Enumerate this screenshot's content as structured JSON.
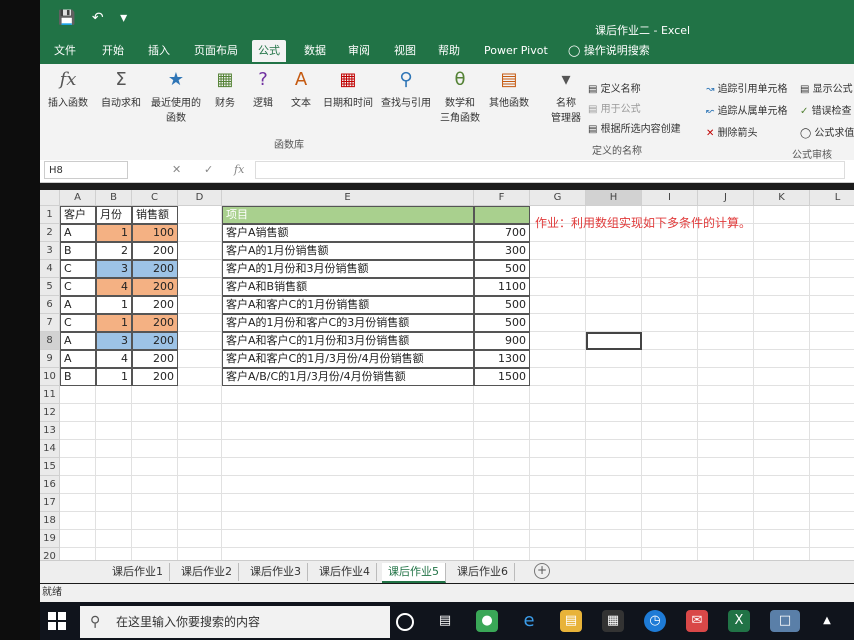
{
  "window": {
    "qat": "💾 ↶ ▾",
    "title": "课后作业二 - Excel"
  },
  "ribbon_tabs": [
    "文件",
    "开始",
    "插入",
    "页面布局",
    "公式",
    "数据",
    "审阅",
    "视图",
    "帮助",
    "Power Pivot",
    "操作说明搜索"
  ],
  "ribbon": {
    "insert_function": "插入函数",
    "autosum": "自动求和",
    "recent_1": "最近使用的",
    "recent_2": "函数",
    "financial": "财务",
    "logical": "逻辑",
    "text": "文本",
    "datetime": "日期和时间",
    "lookup": "查找与引用",
    "math_1": "数学和",
    "math_2": "三角函数",
    "more": "其他函数",
    "group_library": "函数库",
    "name_manager_1": "名称",
    "name_manager_2": "管理器",
    "define_name": "定义名称",
    "use_in_formula": "用于公式",
    "create_from_selection": "根据所选内容创建",
    "group_names": "定义的名称",
    "trace_precedents": "追踪引用单元格",
    "trace_dependents": "追踪从属单元格",
    "remove_arrows": "删除箭头",
    "show_formulas": "显示公式",
    "error_checking": "错误检查",
    "evaluate": "公式求值",
    "group_audit": "公式审核"
  },
  "formula_bar": {
    "namebox": "H8",
    "fx": "fx"
  },
  "columns": [
    "A",
    "B",
    "C",
    "D",
    "E",
    "F",
    "G",
    "H",
    "I",
    "J",
    "K",
    "L"
  ],
  "rows": [
    "1",
    "2",
    "3",
    "4",
    "5",
    "6",
    "7",
    "8",
    "9",
    "10",
    "11",
    "12",
    "13",
    "14",
    "15",
    "16",
    "17",
    "18",
    "19",
    "20"
  ],
  "table1": {
    "headers": [
      "客户",
      "月份",
      "销售额"
    ],
    "rows": [
      [
        "A",
        "1",
        "100"
      ],
      [
        "B",
        "2",
        "200"
      ],
      [
        "C",
        "3",
        "200"
      ],
      [
        "C",
        "4",
        "200"
      ],
      [
        "A",
        "1",
        "200"
      ],
      [
        "C",
        "1",
        "200"
      ],
      [
        "A",
        "3",
        "200"
      ],
      [
        "A",
        "4",
        "200"
      ],
      [
        "B",
        "1",
        "200"
      ]
    ]
  },
  "table2": {
    "header": "项目",
    "rows": [
      [
        "客户A销售额",
        "700"
      ],
      [
        "客户A的1月份销售额",
        "300"
      ],
      [
        "客户A的1月份和3月份销售额",
        "500"
      ],
      [
        "客户A和B销售额",
        "1100"
      ],
      [
        "客户A和客户C的1月份销售额",
        "500"
      ],
      [
        "客户A的1月份和客户C的3月份销售额",
        "500"
      ],
      [
        "客户A和客户C的1月份和3月份销售额",
        "900"
      ],
      [
        "客户A和客户C的1月/3月份/4月份销售额",
        "1300"
      ],
      [
        "客户A/B/C的1月/3月份/4月份销售额",
        "1500"
      ]
    ]
  },
  "note": "作业：利用数组实现如下多条件的计算。",
  "sheet_tabs": [
    "课后作业1",
    "课后作业2",
    "课后作业3",
    "课后作业4",
    "课后作业5",
    "课后作业6"
  ],
  "active_sheet": "课后作业5",
  "status": "就绪",
  "taskbar": {
    "search_placeholder": "在这里输入你要搜索的内容"
  },
  "colors": {
    "accent": "#217346",
    "orange": "#f4b183",
    "blue": "#9dc3e6",
    "header_green": "#a9d08e",
    "note_red": "#e03b3b"
  }
}
